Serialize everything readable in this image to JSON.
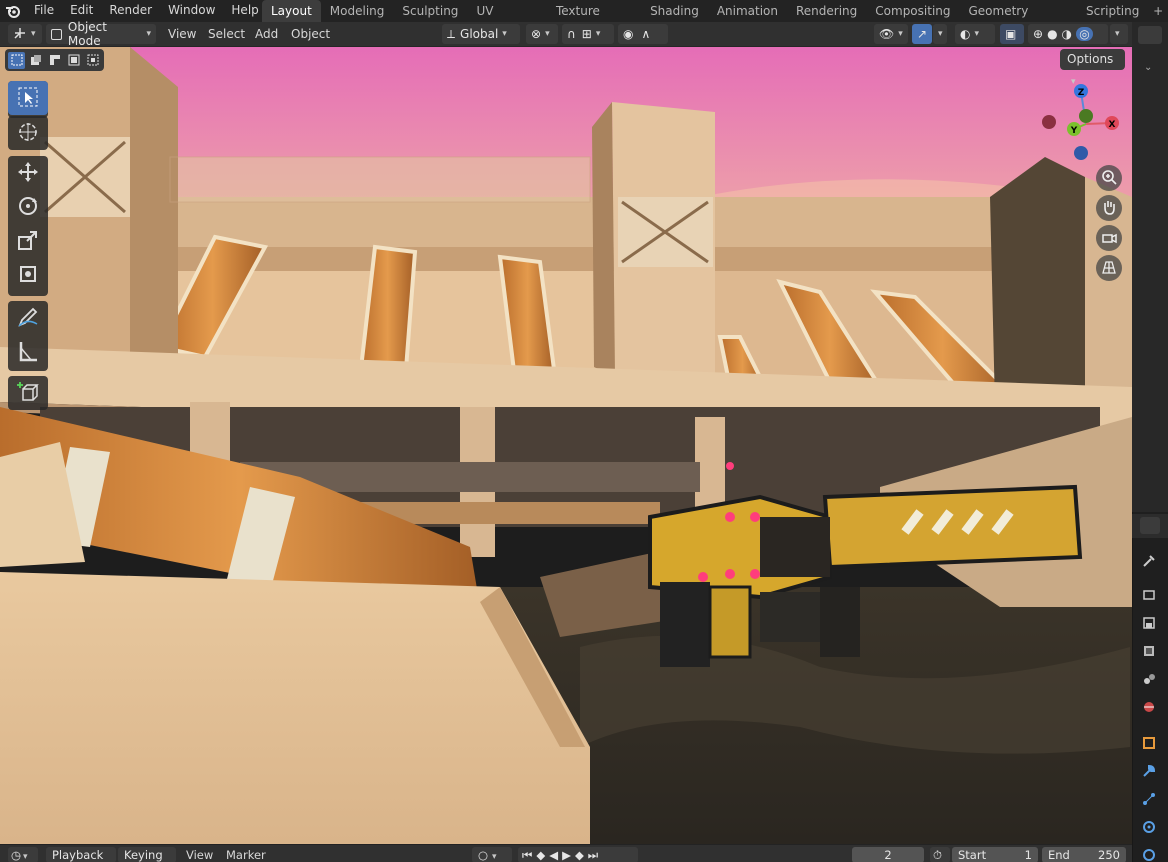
{
  "menubar": {
    "items": [
      "File",
      "Edit",
      "Render",
      "Window",
      "Help"
    ]
  },
  "workspaces": {
    "tabs": [
      "Layout",
      "Modeling",
      "Sculpting",
      "UV Editing",
      "Texture Paint",
      "Shading",
      "Animation",
      "Rendering",
      "Compositing",
      "Geometry Nodes",
      "Scripting"
    ],
    "active": "Layout",
    "add_label": "+"
  },
  "viewport_header": {
    "mode": "Object Mode",
    "menus": [
      "View",
      "Select",
      "Add",
      "Object"
    ],
    "transform_orientation": "Global",
    "options_label": "Options"
  },
  "gizmo": {
    "axes": [
      "Z",
      "Y",
      "X"
    ]
  },
  "timeline": {
    "playback_label": "Playback",
    "keying_label": "Keying",
    "view_label": "View",
    "marker_label": "Marker",
    "current_frame": "2",
    "start_label": "Start",
    "start_value": "1",
    "end_label": "End",
    "end_value": "250"
  },
  "colors": {
    "accent": "#4772b3",
    "sky_top": "#e46fb7",
    "sky_bottom": "#f2b98a",
    "concrete": "#e8c497",
    "pipe": "#d48a3e",
    "robot_yellow": "#d6a72c"
  }
}
